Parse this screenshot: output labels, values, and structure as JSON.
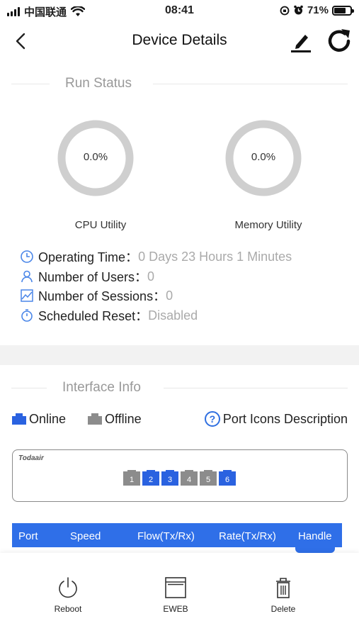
{
  "status_bar": {
    "carrier": "中国联通",
    "time": "08:41",
    "battery": "71%",
    "battery_level": 0.71,
    "wifi_icon": "wifi-icon",
    "alarm_icon": "alarm-icon"
  },
  "header": {
    "title": "Device Details",
    "back_icon": "back-chevron-icon",
    "edit_icon": "edit-pen-icon",
    "refresh_icon": "refresh-icon"
  },
  "run_status": {
    "title": "Run Status",
    "cpu": {
      "value": "0.0%",
      "label": "CPU Utility"
    },
    "memory": {
      "value": "0.0%",
      "label": "Memory Utility"
    },
    "rows": [
      {
        "label": "Operating Time：",
        "value": "0 Days 23 Hours 1 Minutes",
        "icon": "clock-icon"
      },
      {
        "label": "Number of Users：",
        "value": "0",
        "icon": "user-icon"
      },
      {
        "label": "Number of Sessions：",
        "value": "0",
        "icon": "chart-icon"
      },
      {
        "label": "Scheduled Reset：",
        "value": "Disabled",
        "icon": "timer-icon"
      }
    ]
  },
  "interface_info": {
    "title": "Interface Info",
    "legend_online": "Online",
    "legend_offline": "Offline",
    "help_label": "Port Icons Description",
    "device_brand": "Todaair",
    "ports": [
      {
        "label": "1",
        "status": "offline"
      },
      {
        "label": "2",
        "status": "online"
      },
      {
        "label": "3",
        "status": "online"
      },
      {
        "label": "4",
        "status": "offline"
      },
      {
        "label": "5",
        "status": "offline"
      },
      {
        "label": "6",
        "status": "online"
      }
    ],
    "table_columns": [
      "Port",
      "Speed",
      "Flow(Tx/Rx)",
      "Rate(Tx/Rx)",
      "Handle"
    ]
  },
  "colors": {
    "online": "#2a62e0",
    "offline": "#8c8c8c",
    "table_header": "#2f6fe8",
    "gauge_ring": "#cfcfcf"
  },
  "bottom_bar": {
    "reboot": "Reboot",
    "eweb": "EWEB",
    "delete": "Delete"
  }
}
